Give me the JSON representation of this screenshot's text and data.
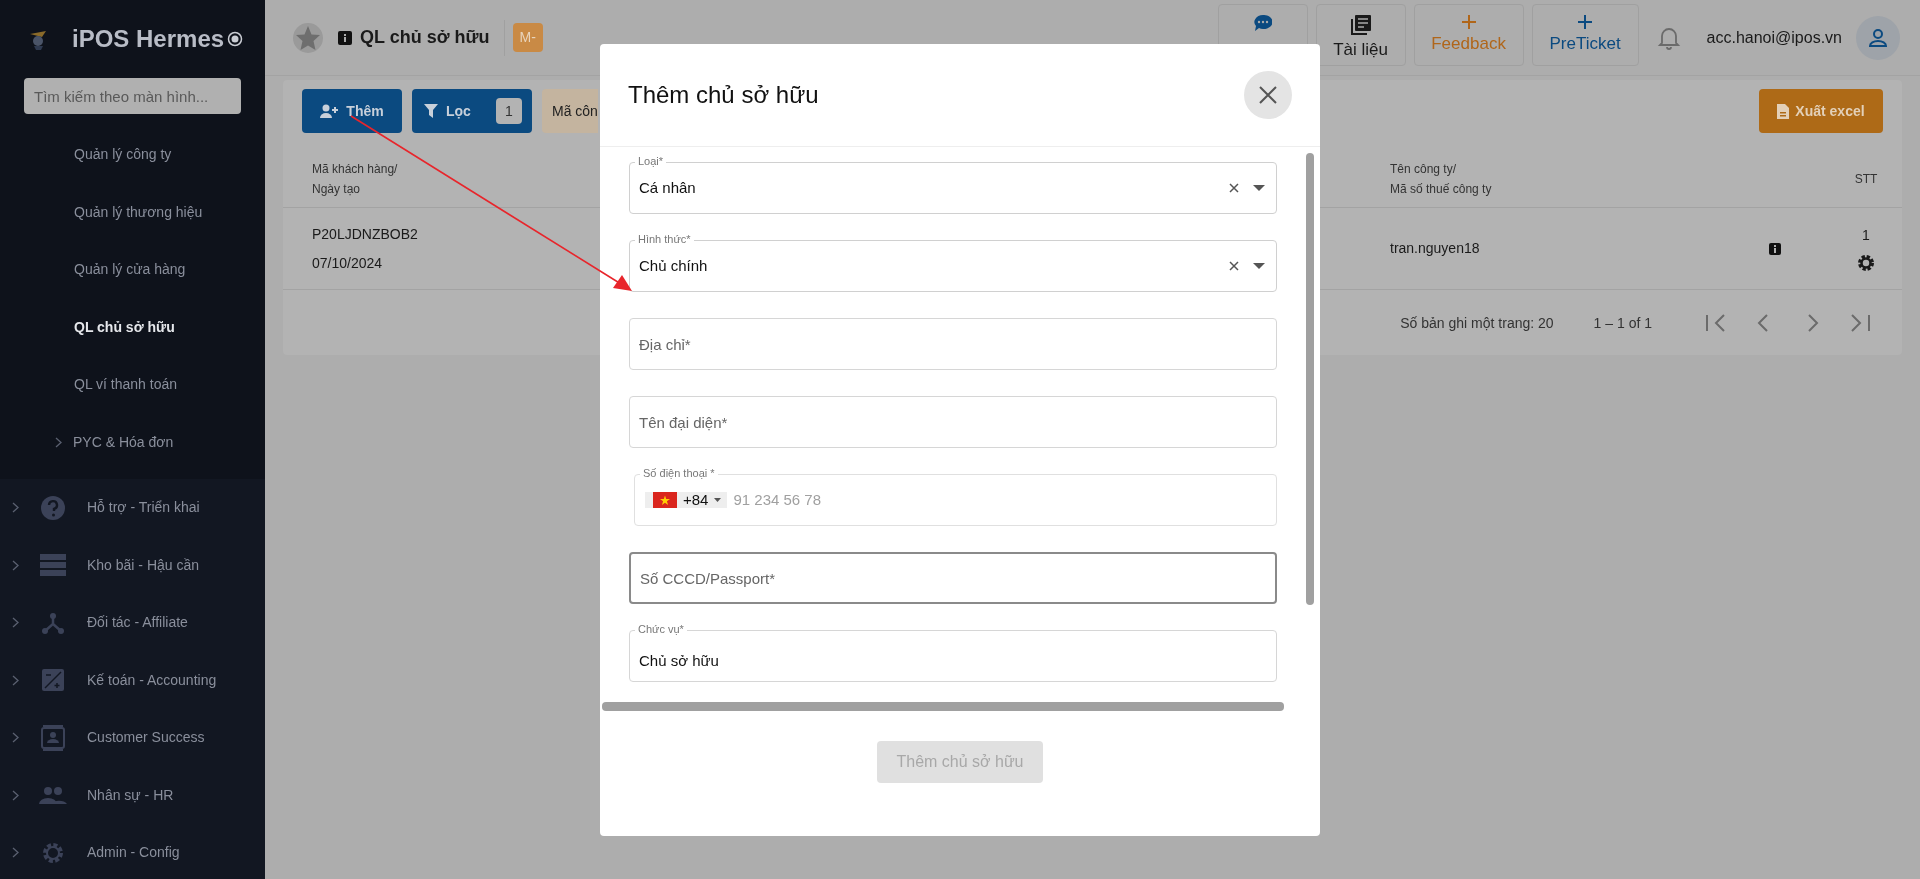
{
  "sidebar": {
    "app_title": "iPOS Hermes",
    "search": {
      "placeholder": "Tìm kiếm theo màn hình..."
    },
    "sub_items": [
      {
        "label": "Quản lý công ty",
        "selected": false
      },
      {
        "label": "Quản lý thương hiệu",
        "selected": false
      },
      {
        "label": "Quản lý cửa hàng",
        "selected": false
      },
      {
        "label": "QL chủ sở hữu",
        "selected": true
      },
      {
        "label": "QL ví thanh toán",
        "selected": false
      },
      {
        "label": "PYC & Hóa đơn",
        "selected": false,
        "expandable": true
      }
    ],
    "sections": [
      {
        "label": "Hỗ trợ - Triển khai"
      },
      {
        "label": "Kho bãi - Hậu cần"
      },
      {
        "label": "Đối tác - Affiliate"
      },
      {
        "label": "Kế toán - Accounting"
      },
      {
        "label": "Customer Success"
      },
      {
        "label": "Nhân sự - HR"
      },
      {
        "label": "Admin - Config"
      }
    ]
  },
  "header": {
    "page_title": "QL chủ sở hữu",
    "badge": "M-",
    "actions": [
      {
        "kind": "bot"
      },
      {
        "kind": "docs",
        "label": "Tài liệu"
      },
      {
        "kind": "feedback",
        "label": "Feedback"
      },
      {
        "kind": "preticket",
        "label": "PreTicket"
      }
    ],
    "user": "acc.hanoi@ipos.vn"
  },
  "toolbar": {
    "add_button": "Thêm",
    "filter_button": {
      "label": "Lọc",
      "count": "1"
    },
    "filter_chip": "Mã côn",
    "export_button": "Xuất excel"
  },
  "table": {
    "columns": [
      {
        "label": "Mã khách hàng/\nNgày tạo"
      },
      {
        "label": "Tên công ty/\nMã số thuế công ty"
      },
      {
        "label": "STT"
      }
    ],
    "rows": [
      {
        "customer_code": "P20LJDNZBOB2",
        "created": "07/10/2024",
        "company": "tran.nguyen18",
        "stt": "1"
      }
    ],
    "pagination": {
      "rows_per_page": "Số bản ghi một trang: 20",
      "range": "1 – 1 of 1"
    }
  },
  "dialog": {
    "title": "Thêm chủ sở hữu",
    "fields": [
      {
        "kind": "select",
        "label": "Loại*",
        "value": "Cá nhân"
      },
      {
        "kind": "select",
        "label": "Hình thức*",
        "value": "Chủ chính"
      },
      {
        "kind": "text",
        "placeholder": "Địa chỉ*",
        "focused": false
      },
      {
        "kind": "text",
        "placeholder": "Tên đại diện*",
        "focused": false
      },
      {
        "kind": "phone",
        "label": "Số điện thoại *",
        "country_code": "+84",
        "placeholder": "91 234 56 78"
      },
      {
        "kind": "text",
        "placeholder": "Số CCCD/Passport*",
        "focused": true
      },
      {
        "kind": "text",
        "label": "Chức vụ*",
        "value": "Chủ sở hữu",
        "focused": false
      }
    ],
    "submit": {
      "label": "Thêm chủ sở hữu",
      "disabled": true
    }
  }
}
